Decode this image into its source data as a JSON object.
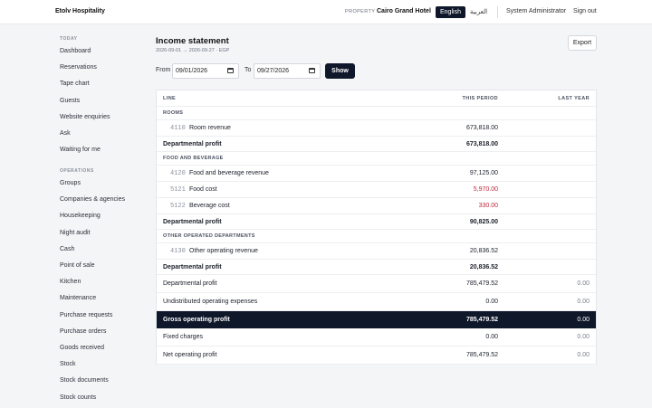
{
  "topbar": {
    "brand": "Etolv Hospitality",
    "property_label": "PROPERTY",
    "property_name": "Cairo Grand Hotel",
    "lang_active": "English",
    "lang_alt": "العربية",
    "user": "System Administrator",
    "sign_out": "Sign out"
  },
  "sidebar": {
    "today_heading": "TODAY",
    "today_items": [
      "Dashboard",
      "Reservations",
      "Tape chart",
      "Guests",
      "Website enquiries",
      "Ask",
      "Waiting for me"
    ],
    "operations_heading": "OPERATIONS",
    "operations_items": [
      "Groups",
      "Companies & agencies",
      "Housekeeping",
      "Night audit",
      "Cash",
      "Point of sale",
      "Kitchen",
      "Maintenance",
      "Purchase requests",
      "Purchase orders",
      "Goods received",
      "Stock",
      "Stock documents",
      "Stock counts"
    ]
  },
  "page": {
    "title": "Income statement",
    "subtitle": "2026-09-01 → 2026-09-27 · EGP",
    "export_label": "Export"
  },
  "filters": {
    "from_label": "From",
    "from_value": "09/01/2026",
    "to_label": "To",
    "to_value": "09/27/2026",
    "show_label": "Show"
  },
  "table": {
    "headers": {
      "line": "LINE",
      "this_period": "THIS PERIOD",
      "last_year": "LAST YEAR"
    },
    "rows": [
      {
        "kind": "section",
        "label": "ROOMS"
      },
      {
        "kind": "line",
        "code": "4110",
        "label": "Room revenue",
        "this": "673,818.00",
        "last": ""
      },
      {
        "kind": "subtotal",
        "label": "Departmental profit",
        "this": "673,818.00",
        "last": ""
      },
      {
        "kind": "section",
        "label": "FOOD AND BEVERAGE"
      },
      {
        "kind": "line",
        "code": "4120",
        "label": "Food and beverage revenue",
        "this": "97,125.00",
        "last": ""
      },
      {
        "kind": "line",
        "code": "5121",
        "label": "Food cost",
        "this": "5,970.00",
        "last": "",
        "negative": true
      },
      {
        "kind": "line",
        "code": "5122",
        "label": "Beverage cost",
        "this": "330.00",
        "last": "",
        "negative": true
      },
      {
        "kind": "subtotal",
        "label": "Departmental profit",
        "this": "90,825.00",
        "last": ""
      },
      {
        "kind": "section",
        "label": "OTHER OPERATED DEPARTMENTS"
      },
      {
        "kind": "line",
        "code": "4130",
        "label": "Other operating revenue",
        "this": "20,836.52",
        "last": ""
      },
      {
        "kind": "subtotal",
        "label": "Departmental profit",
        "this": "20,836.52",
        "last": ""
      },
      {
        "kind": "summary",
        "label": "Departmental profit",
        "this": "785,479.52",
        "last": "0.00"
      },
      {
        "kind": "summary",
        "label": "Undistributed operating expenses",
        "this": "0.00",
        "last": "0.00"
      },
      {
        "kind": "gross",
        "label": "Gross operating profit",
        "this": "785,479.52",
        "last": "0.00"
      },
      {
        "kind": "summary",
        "label": "Fixed charges",
        "this": "0.00",
        "last": "0.00"
      },
      {
        "kind": "summary",
        "label": "Net operating profit",
        "this": "785,479.52",
        "last": "0.00"
      }
    ]
  },
  "colors": {
    "accent": "#0f172a",
    "negative": "#c0283a",
    "background": "#f4f5f7"
  }
}
